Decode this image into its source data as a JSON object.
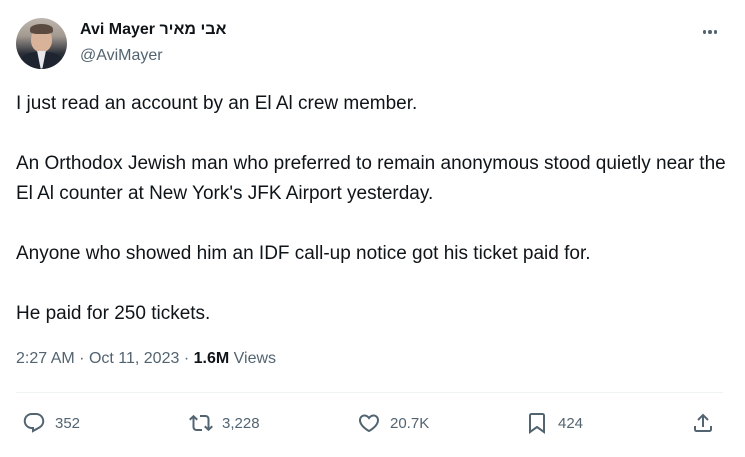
{
  "author": {
    "display_name": "Avi Mayer אבי מאיר",
    "handle": "@AviMayer"
  },
  "tweet": {
    "paragraphs": [
      "I just read an account by an El Al crew member.",
      "An Orthodox Jewish man who preferred to remain anonymous stood quietly near the El Al counter at New York's JFK Airport yesterday.",
      "Anyone who showed him an IDF call-up notice got his ticket paid for.",
      "He paid for 250 tickets."
    ],
    "time": "2:27 AM",
    "separator": "·",
    "date": "Oct 11, 2023",
    "views_count": "1.6M",
    "views_label": "Views"
  },
  "actions": {
    "reply_count": "352",
    "repost_count": "3,228",
    "like_count": "20.7K",
    "bookmark_count": "424"
  },
  "icons": {
    "more": "more-horizontal-icon",
    "reply": "reply-icon",
    "repost": "repost-icon",
    "like": "heart-icon",
    "bookmark": "bookmark-icon",
    "share": "share-icon"
  },
  "colors": {
    "text_primary": "#0f1419",
    "text_secondary": "#536471",
    "divider": "#eff3f4"
  }
}
